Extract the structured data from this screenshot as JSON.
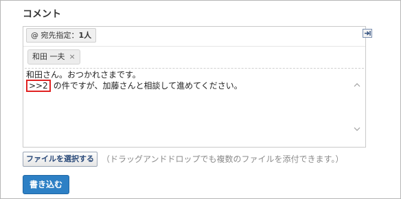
{
  "comment_section": {
    "title": "コメント"
  },
  "editor": {
    "destination_button": {
      "prefix": "@ 宛先指定：",
      "count": "1人"
    },
    "recipients": [
      {
        "name": "和田 一夫",
        "remove": "×"
      }
    ],
    "text": {
      "line1": "和田さん。おつかれさまです。",
      "anchor_ref": ">>2",
      "line2_rest": "の件ですが、加藤さんと相談して進めてください。"
    }
  },
  "attachments": {
    "button_label": "ファイルを選択する",
    "hint": "（ドラッグアンドドロップでも複数のファイルを添付できます。）"
  },
  "actions": {
    "submit_label": "書き込む"
  },
  "colors": {
    "accent": "#2d80c5",
    "highlight_box": "#e02020"
  },
  "icons": {
    "expand": "expand-icon",
    "scroll_up": "chevron-up-icon",
    "scroll_down": "chevron-down-icon"
  }
}
